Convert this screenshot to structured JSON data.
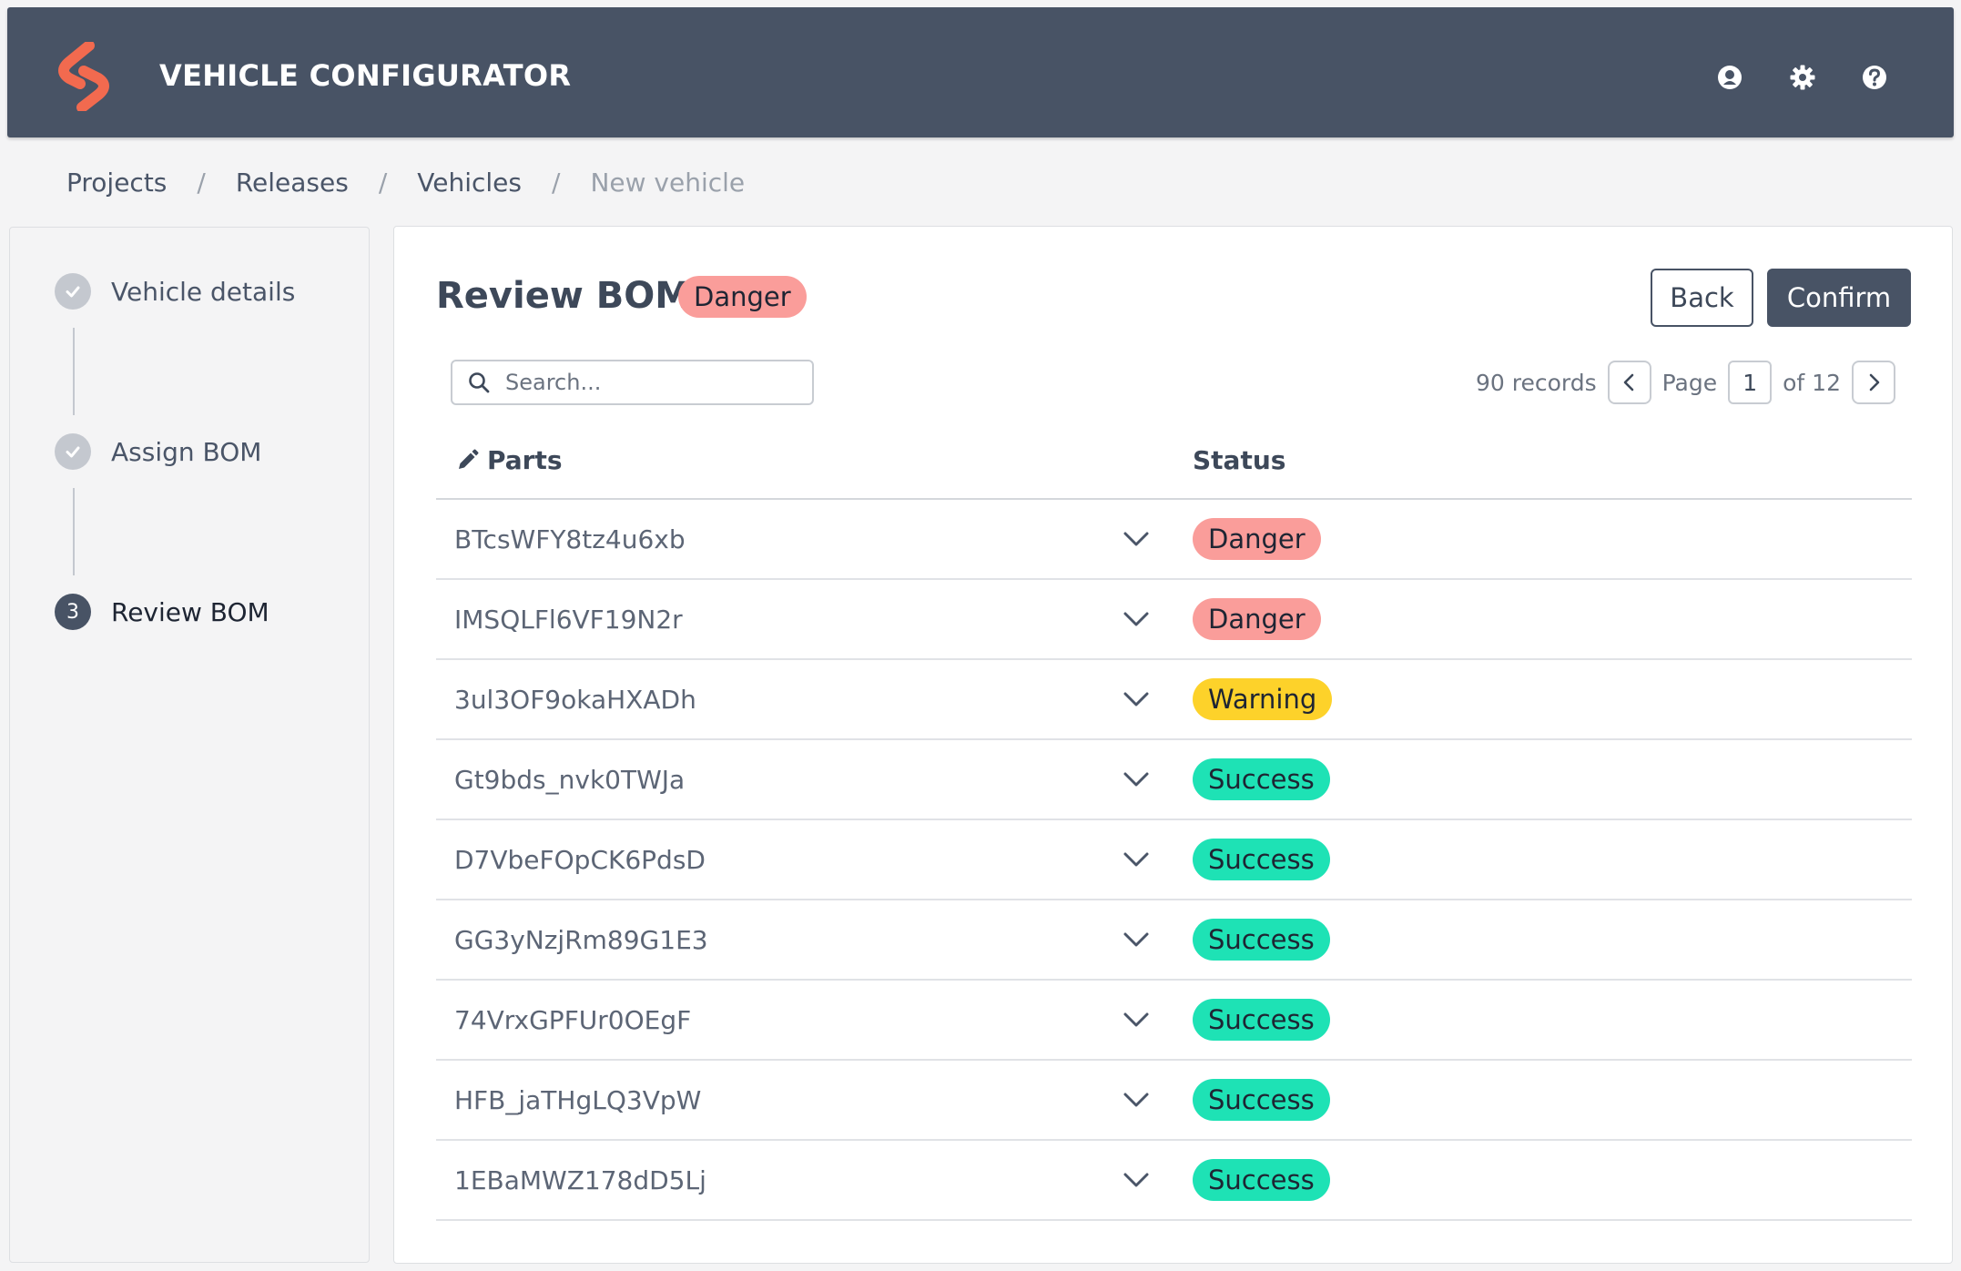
{
  "app": {
    "title": "VEHICLE CONFIGURATOR"
  },
  "header_icons": [
    "user-icon",
    "gear-icon",
    "help-icon"
  ],
  "breadcrumb": [
    "Projects",
    "Releases",
    "Vehicles",
    "New vehicle"
  ],
  "breadcrumb_separator": "/",
  "steps": [
    {
      "label": "Vehicle details",
      "state": "done"
    },
    {
      "label": "Assign BOM",
      "state": "done"
    },
    {
      "label": "Review BOM",
      "state": "active",
      "number": "3"
    }
  ],
  "main": {
    "title": "Review BOM",
    "title_badge": "Danger",
    "back_label": "Back",
    "confirm_label": "Confirm"
  },
  "search": {
    "placeholder": "Search...",
    "value": ""
  },
  "pager": {
    "records": "90 records",
    "page_label": "Page",
    "current_page": "1",
    "of_label": "of 12"
  },
  "table": {
    "columns": [
      "Parts",
      "Status"
    ],
    "rows": [
      {
        "part": "BTcsWFY8tz4u6xb",
        "status": "Danger"
      },
      {
        "part": "IMSQLFl6VF19N2r",
        "status": "Danger"
      },
      {
        "part": "3ul3OF9okaHXADh",
        "status": "Warning"
      },
      {
        "part": "Gt9bds_nvk0TWJa",
        "status": "Success"
      },
      {
        "part": "D7VbeFOpCK6PdsD",
        "status": "Success"
      },
      {
        "part": "GG3yNzjRm89G1E3",
        "status": "Success"
      },
      {
        "part": "74VrxGPFUr0OEgF",
        "status": "Success"
      },
      {
        "part": "HFB_jaTHgLQ3VpW",
        "status": "Success"
      },
      {
        "part": "1EBaMWZ178dD5Lj",
        "status": "Success"
      }
    ]
  },
  "colors": {
    "header_bg": "#485365",
    "accent": "#f26a4f",
    "danger": "#fa9d9a",
    "warning": "#fdd22a",
    "success": "#1ee2b5"
  }
}
